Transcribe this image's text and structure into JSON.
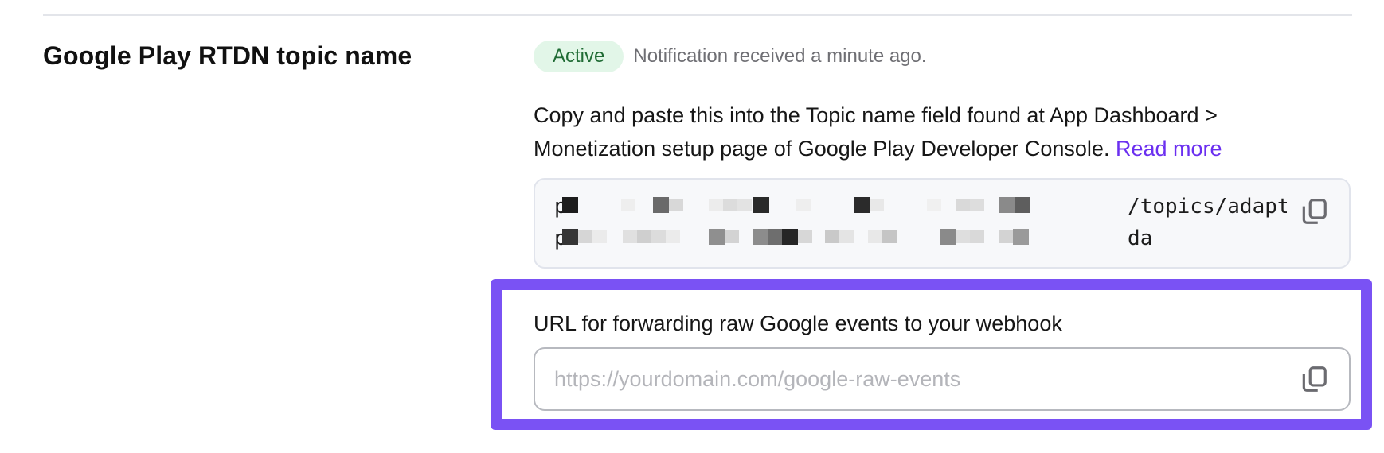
{
  "section": {
    "title": "Google Play RTDN topic name"
  },
  "status": {
    "badge": "Active",
    "text": "Notification received a minute ago."
  },
  "description": {
    "line1": "Copy and paste this into the Topic name field found at App Dashboard >",
    "line2": "Monetization setup page of Google Play Developer Console. ",
    "link": "Read more"
  },
  "topic": {
    "value_line1": "p                                             /topics/adapty-",
    "value_line2": "p                                             da",
    "copy_icon": "copy-icon"
  },
  "webhook": {
    "label": "URL for forwarding raw Google events to your webhook",
    "value": "",
    "placeholder": "https://yourdomain.com/google-raw-events",
    "copy_icon": "copy-icon"
  },
  "colors": {
    "accent": "#7a52f4",
    "link": "#6b2ff0",
    "badge_bg": "#e2f6e8",
    "badge_text": "#1f6b34"
  }
}
